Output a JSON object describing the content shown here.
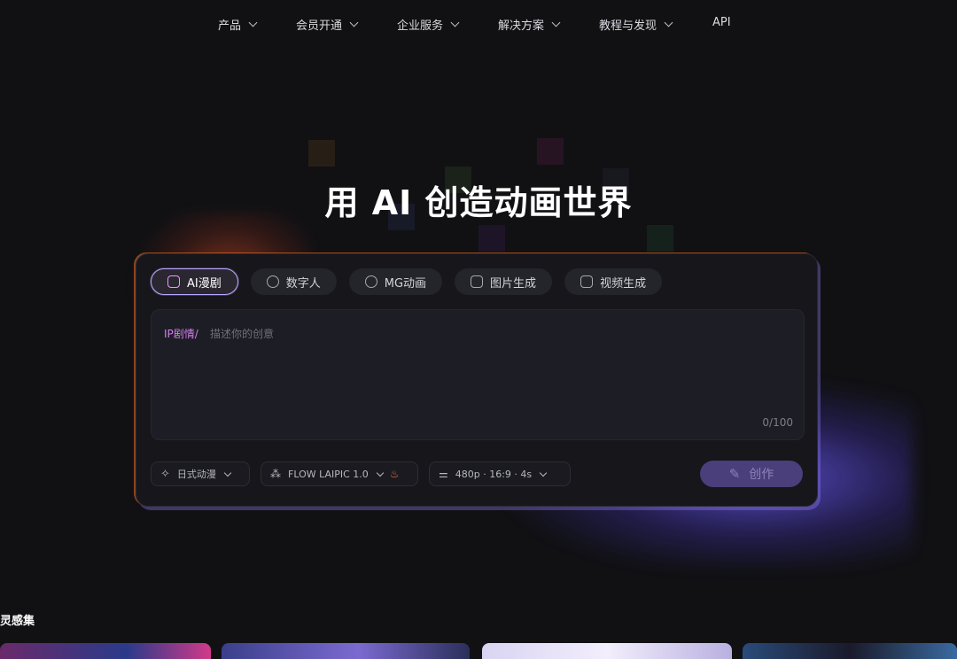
{
  "nav": {
    "items": [
      {
        "label": "产品",
        "has_dropdown": true
      },
      {
        "label": "会员开通",
        "has_dropdown": true
      },
      {
        "label": "企业服务",
        "has_dropdown": true
      },
      {
        "label": "解决方案",
        "has_dropdown": true
      },
      {
        "label": "教程与发现",
        "has_dropdown": true
      },
      {
        "label": "API",
        "has_dropdown": false
      }
    ]
  },
  "hero": {
    "title": "用 AI 创造动画世界"
  },
  "panel": {
    "tabs": [
      {
        "label": "AI漫剧",
        "icon": "comic-icon",
        "active": true
      },
      {
        "label": "数字人",
        "icon": "avatar-icon",
        "active": false
      },
      {
        "label": "MG动画",
        "icon": "play-icon",
        "active": false
      },
      {
        "label": "图片生成",
        "icon": "image-icon",
        "active": false
      },
      {
        "label": "视频生成",
        "icon": "video-icon",
        "active": false
      }
    ],
    "prompt": {
      "prefix": "IP剧情/",
      "placeholder": "描述你的创意",
      "counter": "0/100"
    },
    "style_select": {
      "label": "日式动漫",
      "icon": "sparkle-icon"
    },
    "model_select": {
      "label": "FLOW LAIPIC 1.0",
      "icon": "model-icon",
      "badge": "fire-icon"
    },
    "settings_select": {
      "label": "480p · 16:9 · 4s",
      "icon": "sliders-icon"
    },
    "create_button": {
      "label": "创作",
      "icon": "wand-icon"
    }
  },
  "inspiration": {
    "title": "灵感集"
  },
  "colors": {
    "background": "#111114",
    "accent_purple": "#b9a6ff",
    "accent_pink": "#d67df0",
    "create_button": "#4a3f7a"
  }
}
